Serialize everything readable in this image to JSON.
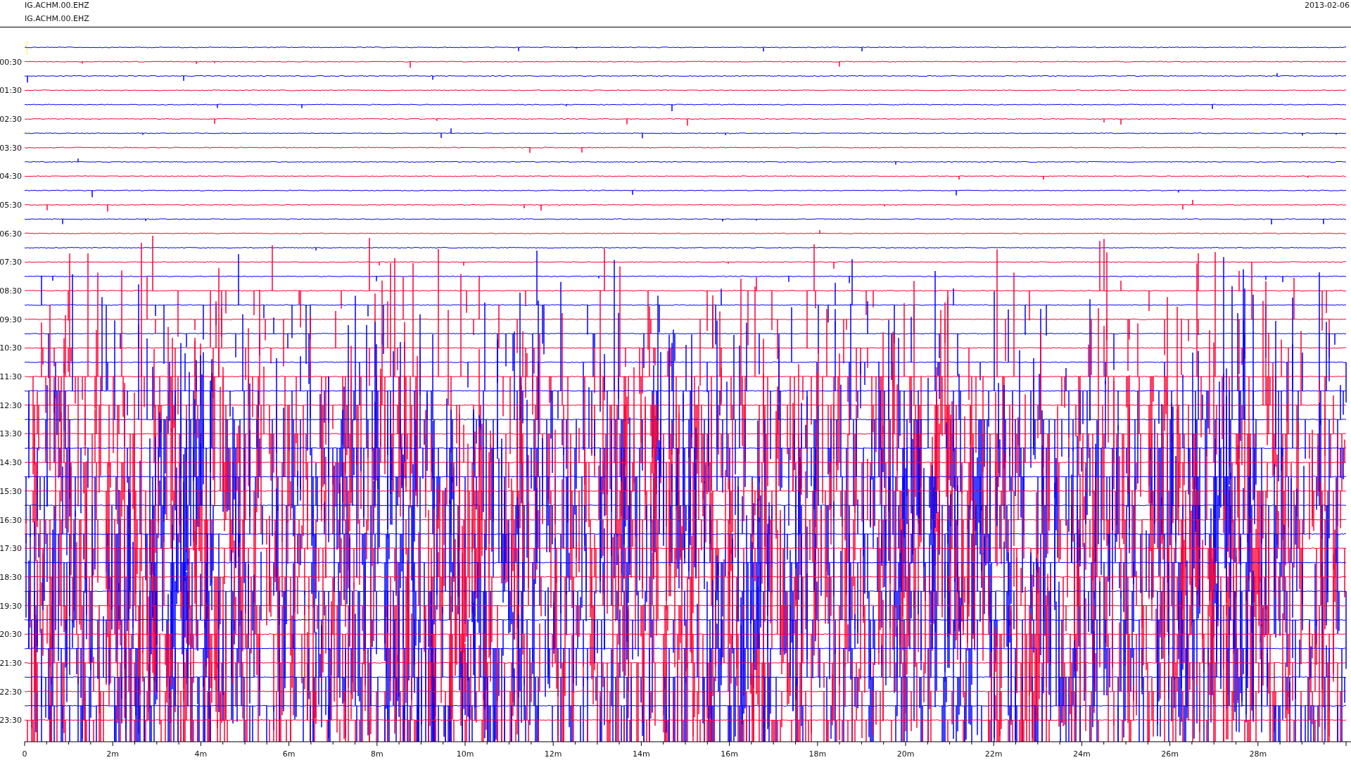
{
  "header": {
    "station_labels": [
      "IG.ACHM.00.EHZ",
      "IG.ACHM.00.EHZ"
    ],
    "date": "2013-02-06"
  },
  "plot": {
    "hour_labels": [
      "00:30",
      "01:30",
      "02:30",
      "03:30",
      "04:30",
      "05:30",
      "06:30",
      "07:30",
      "08:30",
      "09:30",
      "10:30",
      "11:30",
      "12:30",
      "13:30",
      "14:30",
      "15:30",
      "16:30",
      "17:30",
      "18:30",
      "19:30",
      "20:30",
      "21:30",
      "22:30",
      "23:30"
    ],
    "x_tick_labels": [
      "0",
      "2m",
      "4m",
      "6m",
      "8m",
      "10m",
      "12m",
      "14m",
      "16m",
      "18m",
      "20m",
      "22m",
      "24m",
      "26m",
      "28m"
    ],
    "trace_styles": [
      {
        "color": "#0000ff"
      },
      {
        "color": "#ff0033"
      }
    ]
  }
}
